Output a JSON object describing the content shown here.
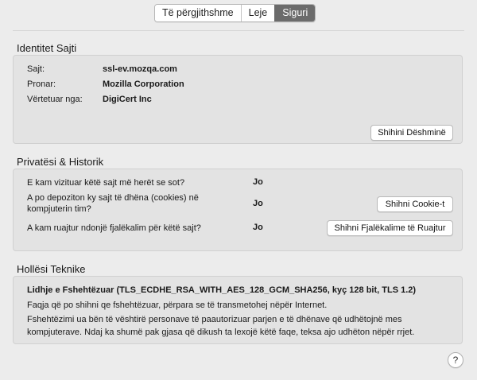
{
  "tabs": [
    {
      "label": "Të përgjithshme",
      "active": false
    },
    {
      "label": "Leje",
      "active": false
    },
    {
      "label": "Siguri",
      "active": true
    }
  ],
  "identity": {
    "title": "Identitet Sajti",
    "site_label": "Sajt:",
    "site_value": "ssl-ev.mozqa.com",
    "owner_label": "Pronar:",
    "owner_value": "Mozilla Corporation",
    "verifier_label": "Vërtetuar nga:",
    "verifier_value": "DigiCert Inc",
    "view_cert_button": "Shihini Dëshminë"
  },
  "privacy": {
    "title": "Privatësi & Historik",
    "q1": "E kam vizituar këtë sajt më herët se sot?",
    "a1": "Jo",
    "q2": "A po depoziton ky sajt të dhëna (cookies) në kompjuterin tim?",
    "a2": "Jo",
    "q3": "A kam ruajtur ndonjë fjalëkalim për këtë sajt?",
    "a3": "Jo",
    "view_cookies_button": "Shihni Cookie-t",
    "view_passwords_button": "Shihni Fjalëkalime të Ruajtur"
  },
  "technical": {
    "title": "Hollësi Teknike",
    "connection": "Lidhje e Fshehtëzuar (TLS_ECDHE_RSA_WITH_AES_128_GCM_SHA256, kyç 128 bit, TLS 1.2)",
    "line1": "Faqja që po shihni qe fshehtëzuar, përpara se të transmetohej nëpër Internet.",
    "line2": "Fshehtëzimi ua bën të vështirë personave të paautorizuar parjen e të dhënave që udhëtojnë mes kompjuterave. Ndaj ka shumë pak gjasa që dikush ta lexojë këtë faqe, teksa ajo udhëton nëpër rrjet."
  },
  "help_button": "?"
}
